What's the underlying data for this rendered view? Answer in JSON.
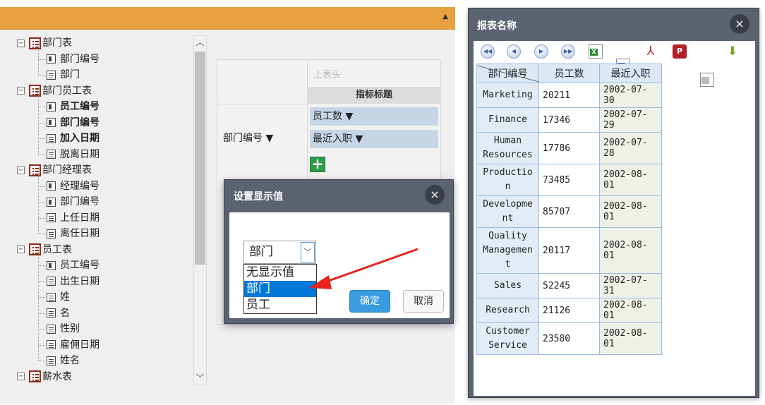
{
  "tree": {
    "nodes": [
      {
        "label": "部门表",
        "type": "table",
        "bold": false
      },
      {
        "label": "部门编号",
        "type": "key",
        "bold": false
      },
      {
        "label": "部门",
        "type": "field",
        "bold": false
      },
      {
        "label": "部门员工表",
        "type": "table",
        "bold": false
      },
      {
        "label": "员工编号",
        "type": "key",
        "bold": true
      },
      {
        "label": "部门编号",
        "type": "key",
        "bold": true
      },
      {
        "label": "加入日期",
        "type": "field",
        "bold": true
      },
      {
        "label": "脱离日期",
        "type": "field",
        "bold": false
      },
      {
        "label": "部门经理表",
        "type": "table",
        "bold": false
      },
      {
        "label": "经理编号",
        "type": "key",
        "bold": false
      },
      {
        "label": "部门编号",
        "type": "key",
        "bold": false
      },
      {
        "label": "上任日期",
        "type": "field",
        "bold": false
      },
      {
        "label": "离任日期",
        "type": "field",
        "bold": false
      },
      {
        "label": "员工表",
        "type": "table",
        "bold": false
      },
      {
        "label": "员工编号",
        "type": "key",
        "bold": false
      },
      {
        "label": "出生日期",
        "type": "field",
        "bold": false
      },
      {
        "label": "姓",
        "type": "field",
        "bold": false
      },
      {
        "label": "名",
        "type": "field",
        "bold": false
      },
      {
        "label": "性别",
        "type": "field",
        "bold": false
      },
      {
        "label": "雇佣日期",
        "type": "field",
        "bold": false
      },
      {
        "label": "姓名",
        "type": "field",
        "bold": false
      },
      {
        "label": "薪水表",
        "type": "table",
        "bold": false
      }
    ]
  },
  "pivot": {
    "column_header_placeholder": "上表头",
    "metric_title": "指标标题",
    "row_field": "部门编号 ▼",
    "measures": [
      "员工数 ▼",
      "最近入职 ▼"
    ],
    "add_label": "+"
  },
  "dialog": {
    "title": "设置显示值",
    "close": "×",
    "select_value": "部门",
    "dropdown_arrow": "﹀",
    "options": [
      "无显示值",
      "部门",
      "员工"
    ],
    "selected_index": 1,
    "ok_label": "确定",
    "cancel_label": "取消"
  },
  "report": {
    "title": "报表名称",
    "close": "×",
    "toolbar": [
      {
        "name": "first-page-icon",
        "glyph": "◀◀",
        "kind": "nav"
      },
      {
        "name": "prev-page-icon",
        "glyph": "◀",
        "kind": "nav"
      },
      {
        "name": "next-page-icon",
        "glyph": "▶",
        "kind": "nav"
      },
      {
        "name": "last-page-icon",
        "glyph": "▶▶",
        "kind": "nav"
      },
      {
        "name": "excel-export-icon",
        "glyph": "X",
        "kind": "doc",
        "color": "#2e8b3a"
      },
      {
        "name": "word-export-icon",
        "glyph": "W",
        "kind": "doc",
        "color": "#2b579a"
      },
      {
        "name": "pdf-export-icon",
        "glyph": "⅄",
        "kind": "pdf",
        "color": "#d0312d"
      },
      {
        "name": "print-icon",
        "glyph": "P",
        "kind": "print",
        "color": "#b3202a"
      },
      {
        "name": "page-setup-icon",
        "glyph": "",
        "kind": "doc",
        "color": "#bbbbbb"
      },
      {
        "name": "download-icon",
        "glyph": "⬇",
        "kind": "arrow",
        "color": "#6aaa2a"
      }
    ],
    "headers": [
      "部门编号",
      "员工数",
      "最近入职"
    ],
    "rows": [
      {
        "dept": "Marketing",
        "count": "20211",
        "date": "2002-07-30"
      },
      {
        "dept": "Finance",
        "count": "17346",
        "date": "2002-07-29"
      },
      {
        "dept": "Human\nResources",
        "count": "17786",
        "date": "2002-07-28"
      },
      {
        "dept": "Productio\nn",
        "count": "73485",
        "date": "2002-08-01"
      },
      {
        "dept": "Developme\nnt",
        "count": "85707",
        "date": "2002-08-01"
      },
      {
        "dept": "Quality\nManagemen\nt",
        "count": "20117",
        "date": "2002-08-01"
      },
      {
        "dept": "Sales",
        "count": "52245",
        "date": "2002-07-31"
      },
      {
        "dept": "Research",
        "count": "21126",
        "date": "2002-08-01"
      },
      {
        "dept": "Customer\nService",
        "count": "23580",
        "date": "2002-08-01"
      }
    ]
  },
  "colors": {
    "top_bar": "#e8a040",
    "dialog_chrome": "#5b6371",
    "selected_option": "#0078d7",
    "ok_button": "#3a9be0",
    "annotation_arrow": "#e8231c",
    "table_border": "#99bce8"
  }
}
